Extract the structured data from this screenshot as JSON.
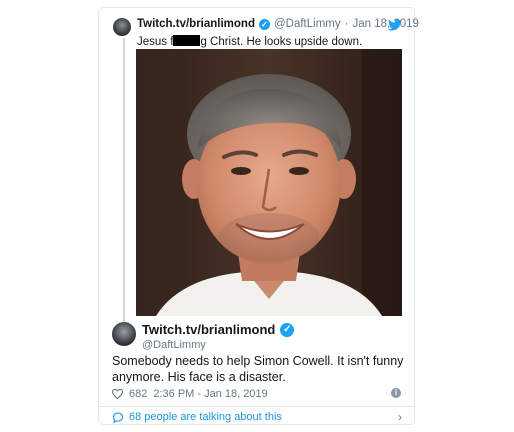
{
  "quoted_tweet": {
    "display_name": "Twitch.tv/brianlimond",
    "handle": "@DaftLimmy",
    "separator": "·",
    "date": "Jan 18, 2019",
    "text_before": "Jesus f",
    "text_after": "g Christ. He looks upside down.",
    "image_alt": "close-up photo of a smiling man with grey hair"
  },
  "main_tweet": {
    "display_name": "Twitch.tv/brianlimond",
    "handle": "@DaftLimmy",
    "text": "Somebody needs to help Simon Cowell. It isn't funny anymore. His face is a disaster.",
    "likes": "682",
    "time": "2:36 PM - Jan 18, 2019"
  },
  "conversation": {
    "label": "68 people are talking about this"
  },
  "colors": {
    "accent": "#1da1f2",
    "link": "#1b95e0",
    "secondary_text": "#657786",
    "border": "#e1e8ed"
  },
  "icons": [
    "twitter-bird-icon",
    "verified-badge-icon",
    "heart-icon",
    "info-icon",
    "comment-bubble-icon",
    "chevron-right-icon"
  ]
}
